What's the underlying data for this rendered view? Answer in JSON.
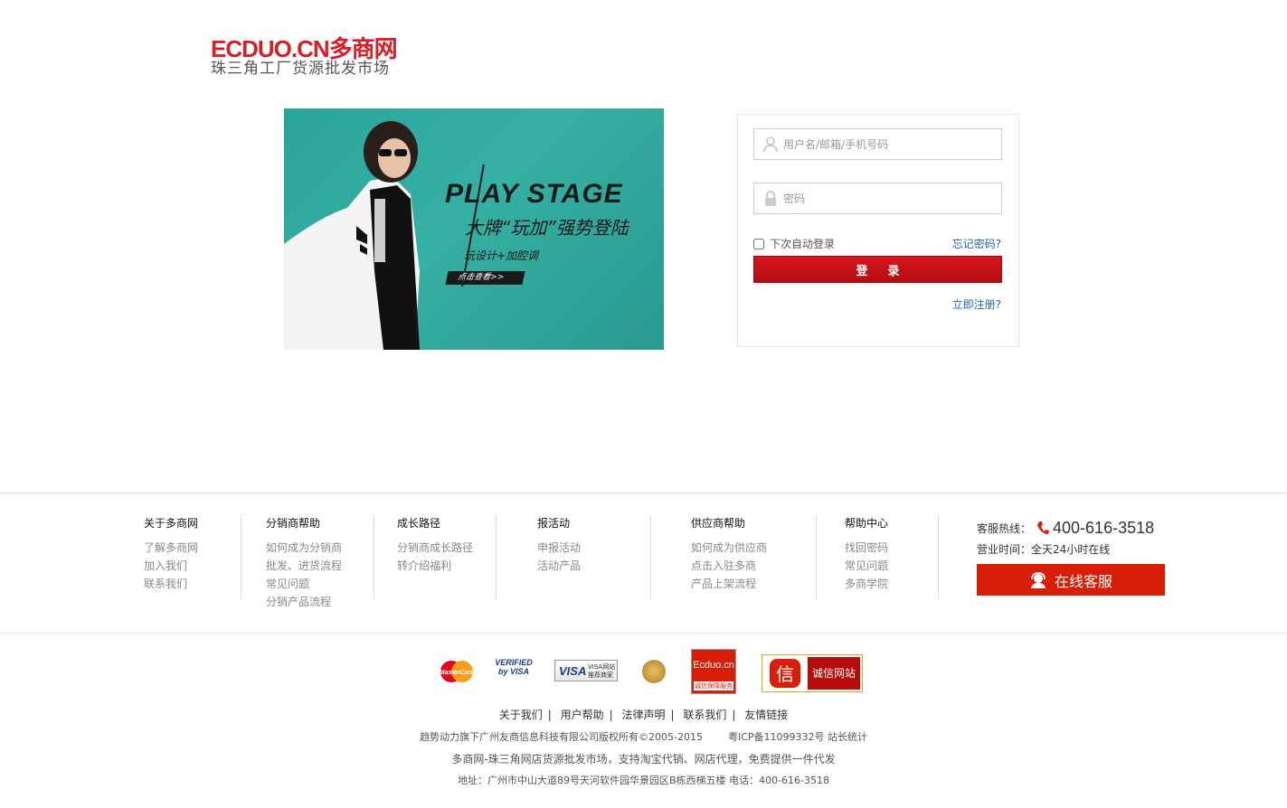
{
  "logo": {
    "brand": "ECDUO.CN多商网",
    "tagline": "珠三角工厂货源批发市场"
  },
  "banner": {
    "title": "PLAY STAGE",
    "subtitle": "大牌“玩加”强势登陆",
    "slogan": "玩设计+加腔调",
    "button_label": "点击查看>>"
  },
  "login": {
    "username_placeholder": "用户名/邮箱/手机号码",
    "username_value": "",
    "password_placeholder": "密码",
    "password_value": "",
    "remember_label": "下次自动登录",
    "forgot_label": "忘记密码?",
    "submit_label": "登录",
    "register_label": "立即注册?"
  },
  "footer": {
    "columns": [
      {
        "title": "关于多商网",
        "links": [
          "了解多商网",
          "加入我们",
          "联系我们"
        ]
      },
      {
        "title": "分销商帮助",
        "links": [
          "如何成为分销商",
          "批发、进货流程",
          "常见问题",
          "分销产品流程"
        ]
      },
      {
        "title": "成长路径",
        "links": [
          "分销商成长路径",
          "转介绍福利"
        ]
      },
      {
        "title": "报活动",
        "links": [
          "申报活动",
          "活动产品"
        ]
      },
      {
        "title": "供应商帮助",
        "links": [
          "如何成为供应商",
          "点击入驻多商",
          "产品上架流程"
        ]
      },
      {
        "title": "帮助中心",
        "links": [
          "找回密码",
          "常见问题",
          "多商学院"
        ]
      }
    ],
    "service": {
      "hotline_label": "客服热线：",
      "hotline_number": "400-616-3518",
      "hours": "营业时间：全天24小时在线",
      "online_button": "在线客服"
    },
    "badges": {
      "mastercard": "MasterCard",
      "verified_visa": "VERIFIED by VISA",
      "visa_merchant_brand": "VISA",
      "visa_merchant_text": "VISA网站 推荐商家",
      "ecduo_badge": "Ecduo.cn",
      "ecduo_badge_sub": "诚信保障服务",
      "credit_icon": "信",
      "credit_site": "诚信网站"
    },
    "bottom_links": [
      "关于我们",
      "用户帮助",
      "法律声明",
      "联系我们",
      "友情链接"
    ],
    "copyright": "趋势动力旗下广州友商信息科技有限公司版权所有©2005-2015",
    "icp": "粤ICP备11099332号",
    "stats": "站长统计",
    "description": "多商网-珠三角网店货源批发市场，支持淘宝代销、网店代理，免费提供一件代发",
    "address": "地址：广州市中山大道89号天河软件园华景园区B栋西梯五楼 电话：400-616-3518"
  },
  "colors": {
    "brand_red": "#d61f26",
    "link_blue": "#2366b3",
    "banner_teal": "#2aa59a",
    "login_button": "#c8121a"
  }
}
